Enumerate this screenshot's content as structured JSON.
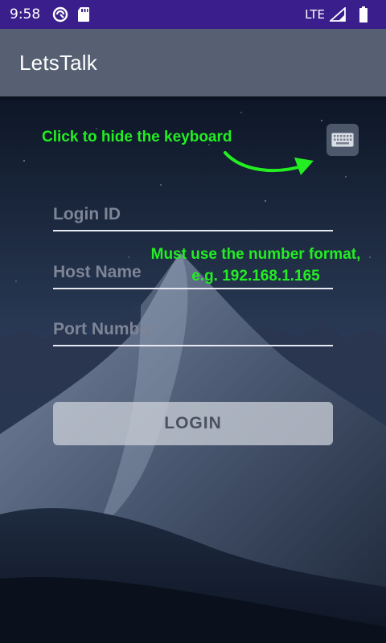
{
  "status_bar": {
    "time": "9:58",
    "network": "LTE"
  },
  "app_bar": {
    "title": "LetsTalk"
  },
  "hints": {
    "keyboard": "Click to hide the keyboard",
    "number_line1": "Must use the number format,",
    "number_line2": "e.g. 192.168.1.165"
  },
  "form": {
    "login_id": {
      "placeholder": "Login ID",
      "value": ""
    },
    "host_name": {
      "placeholder": "Host Name",
      "value": ""
    },
    "port_number": {
      "placeholder": "Port Number",
      "value": ""
    },
    "login_label": "LOGIN"
  },
  "icons": {
    "keyboard_button": "keyboard-icon",
    "status": [
      "vpn-icon",
      "sd-card-icon",
      "signal-icon",
      "battery-icon"
    ]
  },
  "colors": {
    "status_bar": "#3a1f8c",
    "app_bar": "#566072",
    "hint_text": "#22ee22",
    "field_underline": "#e6e9ef",
    "login_button": "#c8cdd6"
  }
}
